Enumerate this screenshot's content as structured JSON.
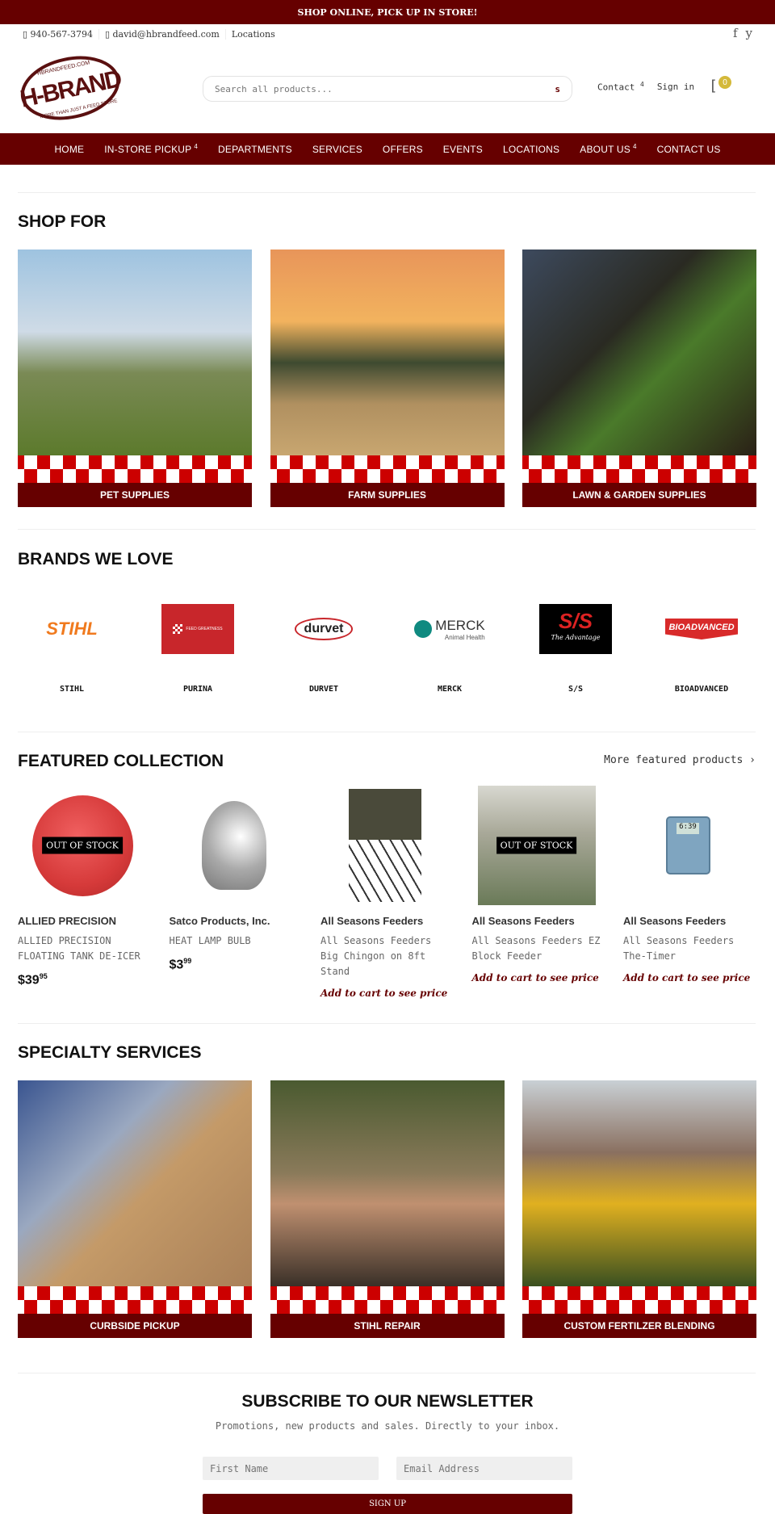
{
  "topbar": {
    "message": "SHOP ONLINE, PICK UP IN STORE!"
  },
  "contact": {
    "phone": "▯ 940-567-3794",
    "email": "▯ david@hbrandfeed.com",
    "locations": "Locations"
  },
  "social": {
    "facebook": "f",
    "youtube": "y"
  },
  "logo": {
    "main": "H-BRAND",
    "top": "HBRANDFEED.COM",
    "bottom": "MORE THAN JUST A FEED STORE"
  },
  "search": {
    "placeholder": "Search all products...",
    "icon": "s"
  },
  "header": {
    "contact": "Contact",
    "contact_caret": "4",
    "signin": "Sign in",
    "cart_icon": "[",
    "cart_count": "0"
  },
  "nav": [
    {
      "label": "HOME"
    },
    {
      "label": "IN-STORE PICKUP",
      "caret": "4"
    },
    {
      "label": "DEPARTMENTS"
    },
    {
      "label": "SERVICES"
    },
    {
      "label": "OFFERS"
    },
    {
      "label": "EVENTS"
    },
    {
      "label": "LOCATIONS"
    },
    {
      "label": "ABOUT US",
      "caret": "4"
    },
    {
      "label": "CONTACT US"
    }
  ],
  "shop_for": {
    "title": "SHOP FOR",
    "cards": [
      {
        "label": "PET SUPPLIES"
      },
      {
        "label": "FARM SUPPLIES"
      },
      {
        "label": "LAWN & GARDEN SUPPLIES"
      }
    ]
  },
  "brands": {
    "title": "BRANDS WE LOVE",
    "items": [
      {
        "name": "STIHL",
        "logo": "STIHL"
      },
      {
        "name": "PURINA",
        "logo": "FEED GREATNESS"
      },
      {
        "name": "DURVET",
        "logo": "durvet"
      },
      {
        "name": "MERCK",
        "logo": "MERCK",
        "logo_sub": "Animal Health"
      },
      {
        "name": "S/S",
        "logo": "S/S",
        "logo_sub": "The Advantage"
      },
      {
        "name": "BIOADVANCED",
        "logo": "BIOADVANCED"
      }
    ]
  },
  "featured": {
    "title": "FEATURED COLLECTION",
    "more": "More featured products ›",
    "products": [
      {
        "vendor": "ALLIED PRECISION",
        "name": "ALLIED PRECISION FLOATING TANK DE-ICER",
        "price": "$39",
        "cents": "95",
        "badge": "OUT OF STOCK"
      },
      {
        "vendor": "Satco Products, Inc.",
        "name": "HEAT LAMP BULB",
        "price": "$3",
        "cents": "99"
      },
      {
        "vendor": "All Seasons Feeders",
        "name": "All Seasons Feeders Big Chingon on 8ft Stand",
        "atc": "Add to cart to see price"
      },
      {
        "vendor": "All Seasons Feeders",
        "name": "All Seasons Feeders EZ Block Feeder",
        "atc": "Add to cart to see price",
        "badge": "OUT OF STOCK"
      },
      {
        "vendor": "All Seasons Feeders",
        "name": "All Seasons Feeders The-Timer",
        "atc": "Add to cart to see price",
        "display": "6:39"
      }
    ]
  },
  "services": {
    "title": "SPECIALTY SERVICES",
    "cards": [
      {
        "label": "CURBSIDE PICKUP"
      },
      {
        "label": "STIHL REPAIR"
      },
      {
        "label": "CUSTOM FERTILZER BLENDING"
      }
    ]
  },
  "newsletter": {
    "title": "SUBSCRIBE TO OUR NEWSLETTER",
    "subtitle": "Promotions, new products and sales. Directly to your inbox.",
    "first_name_placeholder": "First Name",
    "email_placeholder": "Email Address",
    "button": "SIGN UP"
  },
  "colors": {
    "brand": "#660000",
    "checker": "#cc0000",
    "badge": "#d4b93a"
  }
}
